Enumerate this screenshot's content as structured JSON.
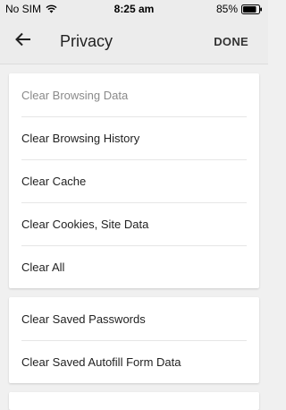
{
  "status_bar": {
    "carrier": "No SIM",
    "time": "8:25 am",
    "battery": "85%"
  },
  "app_bar": {
    "title": "Privacy",
    "done_label": "DONE"
  },
  "sections": [
    {
      "header": "Clear Browsing Data",
      "items": [
        {
          "label": "Clear Browsing History"
        },
        {
          "label": "Clear Cache"
        },
        {
          "label": "Clear Cookies, Site Data"
        },
        {
          "label": "Clear All"
        }
      ]
    },
    {
      "items": [
        {
          "label": "Clear Saved Passwords"
        },
        {
          "label": "Clear Saved Autofill Form Data"
        }
      ]
    }
  ]
}
